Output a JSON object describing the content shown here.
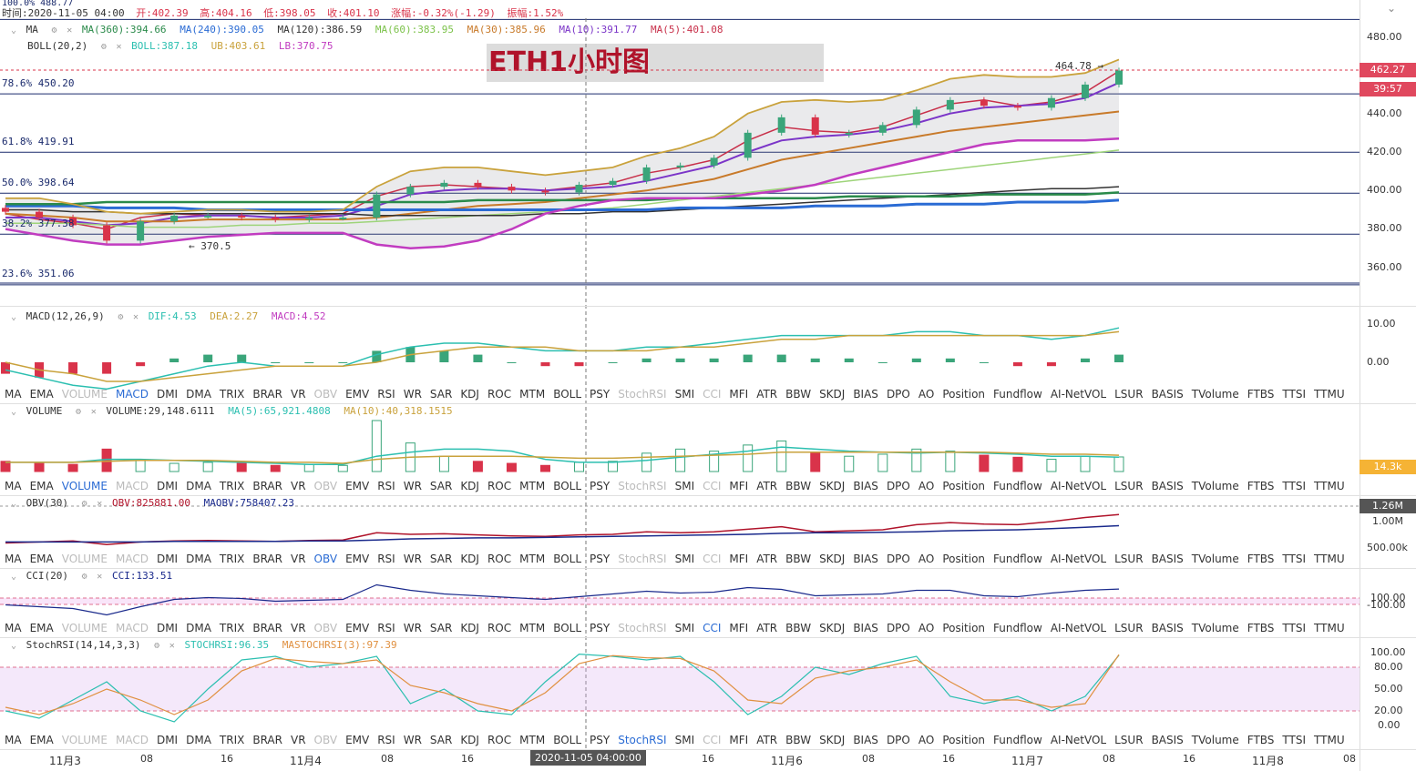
{
  "top": {
    "corner_label": "100.0% 488.77",
    "time": "时间:2020-11-05 04:00",
    "open": "开:402.39",
    "high": "高:404.16",
    "low": "低:398.05",
    "close": "收:401.10",
    "change": "涨幅:-0.32%(-1.29)",
    "amplitude": "振幅:1.52%"
  },
  "ma_legend": {
    "name": "MA",
    "ma360": "MA(360):394.66",
    "ma240": "MA(240):390.05",
    "ma120": "MA(120):386.59",
    "ma60": "MA(60):383.95",
    "ma30": "MA(30):385.96",
    "ma10": "MA(10):391.77",
    "ma5": "MA(5):401.08"
  },
  "boll_legend": {
    "name": "BOLL(20,2)",
    "boll": "BOLL:387.18",
    "ub": "UB:403.61",
    "lb": "LB:370.75"
  },
  "banner": "ETH1小时图",
  "fib": {
    "f786": "78.6% 450.20",
    "f618": "61.8% 419.91",
    "f500": "50.0% 398.64",
    "f382": "38.2% 377.38",
    "f236": "23.6% 351.06"
  },
  "annotations": {
    "high_mark": "464.78 →",
    "low_mark": "← 370.5"
  },
  "price_axis": [
    "480.00",
    "460.00",
    "440.00",
    "420.00",
    "400.00",
    "380.00",
    "360.00"
  ],
  "price_tag": "462.27",
  "countdown_tag": "39:57",
  "macd_legend": {
    "name": "MACD(12,26,9)",
    "dif": "DIF:4.53",
    "dea": "DEA:2.27",
    "macd": "MACD:4.52"
  },
  "macd_axis": [
    "10.00",
    "0.00"
  ],
  "volume_legend": {
    "name": "VOLUME",
    "volume": "VOLUME:29,148.6111",
    "ma5": "MA(5):65,921.4808",
    "ma10": "MA(10):40,318.1515"
  },
  "volume_tag": "14.3k",
  "obv_legend": {
    "name": "OBV(30)",
    "obv": "OBV:825881.00",
    "maobv": "MAOBV:758407.23"
  },
  "obv_tag": "1.26M",
  "obv_axis": [
    "1.00M",
    "500.00k"
  ],
  "cci_legend": {
    "name": "CCI(20)",
    "cci": "CCI:133.51"
  },
  "cci_axis": [
    "100.00",
    "-100.00"
  ],
  "stoch_legend": {
    "name": "StochRSI(14,14,3,3)",
    "stoch": "STOCHRSI:96.35",
    "ma": "MASTOCHRSI(3):97.39"
  },
  "stoch_axis": [
    "100.00",
    "80.00",
    "50.00",
    "20.00",
    "0.00"
  ],
  "tabs": [
    "MA",
    "EMA",
    "VOLUME",
    "MACD",
    "DMI",
    "DMA",
    "TRIX",
    "BRAR",
    "VR",
    "OBV",
    "EMV",
    "RSI",
    "WR",
    "SAR",
    "KDJ",
    "ROC",
    "MTM",
    "BOLL",
    "PSY",
    "StochRSI",
    "SMI",
    "CCI",
    "MFI",
    "ATR",
    "BBW",
    "SKDJ",
    "BIAS",
    "DPO",
    "AO",
    "Position",
    "Fundflow",
    "AI-NetVOL",
    "LSUR",
    "BASIS",
    "TVolume",
    "FTBS",
    "TTSI",
    "TTMU"
  ],
  "x_axis": [
    "11月3",
    "08",
    "16",
    "11月4",
    "08",
    "16",
    "16",
    "11月6",
    "08",
    "16",
    "11月7",
    "08",
    "16",
    "11月8",
    "08"
  ],
  "x_cursor": "2020-11-05 04:00:00",
  "colors": {
    "up": "#3aa57a",
    "down": "#d9334a",
    "boll": "#c9a23c",
    "ma5": "#c8304a",
    "ma10": "#7b35c8",
    "ma30": "#c87a2a",
    "ma60": "#9ed47a",
    "ma120": "#333333",
    "ma240": "#2a6bd4",
    "ma360": "#2a8a4a",
    "lb": "#c13cc0",
    "dif": "#2bbfb0",
    "dea": "#c9a23c"
  },
  "chart_data": {
    "type": "candlestick",
    "symbol": "ETH",
    "interval": "1h",
    "ylim": [
      340,
      490
    ],
    "fib_levels": [
      {
        "level": "100.0%",
        "price": 488.77
      },
      {
        "level": "78.6%",
        "price": 450.2
      },
      {
        "level": "61.8%",
        "price": 419.91
      },
      {
        "level": "50.0%",
        "price": 398.64
      },
      {
        "level": "38.2%",
        "price": 377.38
      },
      {
        "level": "23.6%",
        "price": 351.06
      }
    ],
    "ma_series": [
      {
        "name": "MA(5)",
        "values": [
          388,
          385,
          383,
          380,
          386,
          388,
          387,
          387,
          386,
          387,
          388,
          397,
          402,
          403,
          402,
          401,
          400,
          402,
          404,
          409,
          412,
          416,
          426,
          433,
          431,
          430,
          433,
          439,
          445,
          447,
          444,
          446,
          451,
          462
        ]
      },
      {
        "name": "MA(10)",
        "values": [
          386,
          386,
          384,
          382,
          383,
          386,
          387,
          387,
          386,
          386,
          387,
          392,
          398,
          400,
          401,
          401,
          400,
          401,
          402,
          405,
          409,
          413,
          420,
          426,
          428,
          429,
          431,
          435,
          440,
          443,
          444,
          445,
          448,
          456
        ]
      },
      {
        "name": "MA(30)",
        "values": [
          388,
          387,
          386,
          384,
          384,
          384,
          385,
          385,
          385,
          385,
          385,
          386,
          388,
          390,
          392,
          393,
          394,
          396,
          398,
          400,
          403,
          406,
          411,
          416,
          419,
          422,
          425,
          428,
          431,
          433,
          435,
          437,
          439,
          441
        ]
      },
      {
        "name": "MA(60)",
        "values": [
          383,
          383,
          383,
          382,
          381,
          381,
          381,
          382,
          382,
          383,
          383,
          384,
          385,
          386,
          387,
          388,
          389,
          390,
          391,
          393,
          395,
          397,
          399,
          401,
          403,
          405,
          407,
          409,
          411,
          413,
          415,
          417,
          419,
          421
        ]
      },
      {
        "name": "MA(120)",
        "values": [
          390,
          390,
          389,
          389,
          388,
          388,
          388,
          388,
          388,
          388,
          388,
          387,
          387,
          387,
          387,
          387,
          388,
          388,
          389,
          389,
          390,
          391,
          392,
          393,
          394,
          395,
          396,
          397,
          398,
          399,
          400,
          401,
          401,
          402
        ]
      },
      {
        "name": "MA(240)",
        "values": [
          392,
          392,
          392,
          391,
          391,
          391,
          390,
          390,
          390,
          390,
          390,
          390,
          390,
          390,
          390,
          390,
          390,
          390,
          390,
          390,
          391,
          391,
          391,
          391,
          392,
          392,
          392,
          393,
          393,
          393,
          394,
          394,
          394,
          395
        ]
      },
      {
        "name": "MA(360)",
        "values": [
          393,
          393,
          393,
          394,
          394,
          394,
          394,
          394,
          394,
          394,
          394,
          394,
          394,
          394,
          395,
          395,
          395,
          395,
          395,
          395,
          396,
          396,
          396,
          396,
          396,
          397,
          397,
          397,
          397,
          398,
          398,
          398,
          398,
          399
        ]
      },
      {
        "name": "UB",
        "values": [
          396,
          396,
          393,
          389,
          388,
          389,
          390,
          390,
          389,
          389,
          390,
          402,
          410,
          412,
          412,
          410,
          408,
          410,
          412,
          418,
          422,
          428,
          440,
          446,
          447,
          446,
          447,
          452,
          458,
          460,
          459,
          459,
          461,
          468
        ]
      },
      {
        "name": "LB",
        "values": [
          380,
          377,
          374,
          372,
          372,
          374,
          376,
          377,
          378,
          378,
          378,
          372,
          370,
          371,
          374,
          380,
          388,
          392,
          395,
          396,
          396,
          396,
          398,
          400,
          403,
          408,
          412,
          416,
          420,
          424,
          426,
          426,
          426,
          427
        ]
      }
    ],
    "candles_close": [
      389,
      386,
      382,
      374,
      384,
      387,
      387,
      386,
      385,
      386,
      386,
      398,
      402,
      404,
      402,
      400,
      399,
      403,
      405,
      412,
      413,
      417,
      430,
      438,
      429,
      430,
      434,
      442,
      447,
      444,
      443,
      448,
      455,
      462.27
    ],
    "candles_open": [
      391,
      389,
      386,
      382,
      374,
      384,
      387,
      387,
      386,
      385,
      386,
      386,
      398,
      402,
      404,
      402,
      400,
      399,
      403,
      405,
      412,
      413,
      417,
      430,
      438,
      429,
      430,
      434,
      442,
      447,
      444,
      443,
      448,
      455
    ],
    "macd": {
      "dif": [
        -2,
        -4,
        -6,
        -7,
        -5,
        -3,
        -1,
        0,
        -1,
        -1,
        -1,
        2,
        4,
        5,
        5,
        4,
        3,
        3,
        3,
        4,
        4,
        5,
        6,
        7,
        7,
        7,
        7,
        8,
        8,
        7,
        7,
        6,
        7,
        9
      ],
      "dea": [
        0,
        -2,
        -3,
        -5,
        -5,
        -4,
        -3,
        -2,
        -1,
        -1,
        -1,
        0,
        2,
        3,
        4,
        4,
        4,
        3,
        3,
        3,
        4,
        4,
        5,
        6,
        6,
        7,
        7,
        7,
        7,
        7,
        7,
        7,
        7,
        8
      ],
      "hist": [
        -3,
        -4,
        -3,
        -3,
        -1,
        1,
        2,
        2,
        0,
        0,
        0,
        3,
        4,
        3,
        2,
        0,
        -1,
        -1,
        0,
        1,
        1,
        1,
        2,
        2,
        1,
        1,
        0,
        1,
        1,
        0,
        -1,
        -1,
        1,
        2
      ]
    },
    "volume": {
      "values": [
        10,
        8,
        7,
        22,
        12,
        8,
        9,
        8,
        6,
        7,
        6,
        50,
        28,
        15,
        10,
        8,
        6,
        9,
        10,
        18,
        22,
        20,
        26,
        30,
        18,
        15,
        17,
        22,
        20,
        16,
        14,
        12,
        15,
        14.3
      ],
      "ma5": [
        9,
        9,
        9,
        12,
        12,
        11,
        10,
        9,
        8,
        7,
        7,
        15,
        19,
        22,
        22,
        20,
        12,
        9,
        9,
        11,
        14,
        17,
        20,
        24,
        22,
        20,
        19,
        18,
        19,
        18,
        17,
        15,
        15,
        14
      ],
      "ma10": [
        9,
        9,
        9,
        10,
        11,
        11,
        11,
        10,
        9,
        9,
        8,
        12,
        14,
        15,
        15,
        15,
        14,
        13,
        13,
        14,
        15,
        16,
        17,
        19,
        19,
        19,
        19,
        19,
        19,
        19,
        18,
        17,
        17,
        16
      ]
    },
    "obv": {
      "obv": [
        0.58,
        0.6,
        0.62,
        0.55,
        0.6,
        0.62,
        0.63,
        0.62,
        0.61,
        0.63,
        0.64,
        0.78,
        0.75,
        0.76,
        0.74,
        0.72,
        0.71,
        0.74,
        0.75,
        0.8,
        0.78,
        0.8,
        0.85,
        0.9,
        0.8,
        0.82,
        0.84,
        0.94,
        0.98,
        0.95,
        0.94,
        1.0,
        1.08,
        1.14
      ],
      "maobv": [
        0.6,
        0.6,
        0.6,
        0.6,
        0.6,
        0.61,
        0.61,
        0.61,
        0.61,
        0.62,
        0.62,
        0.64,
        0.66,
        0.67,
        0.68,
        0.68,
        0.69,
        0.7,
        0.71,
        0.72,
        0.73,
        0.74,
        0.75,
        0.77,
        0.78,
        0.78,
        0.79,
        0.8,
        0.82,
        0.83,
        0.84,
        0.86,
        0.89,
        0.92
      ]
    },
    "cci": [
      -40,
      -60,
      -80,
      -150,
      -60,
      20,
      40,
      30,
      0,
      10,
      20,
      180,
      120,
      80,
      60,
      40,
      20,
      50,
      80,
      110,
      90,
      100,
      150,
      130,
      60,
      70,
      80,
      120,
      120,
      60,
      50,
      90,
      120,
      133.51
    ],
    "stochrsi": {
      "k": [
        20,
        10,
        35,
        60,
        20,
        5,
        50,
        90,
        95,
        80,
        85,
        95,
        30,
        50,
        20,
        15,
        60,
        98,
        95,
        90,
        95,
        60,
        15,
        40,
        80,
        70,
        85,
        95,
        40,
        30,
        40,
        20,
        40,
        96.35
      ],
      "d": [
        25,
        15,
        30,
        50,
        35,
        15,
        35,
        75,
        92,
        88,
        85,
        90,
        55,
        45,
        30,
        20,
        45,
        85,
        96,
        93,
        92,
        75,
        35,
        30,
        65,
        75,
        80,
        90,
        60,
        35,
        35,
        25,
        30,
        97.39
      ]
    }
  }
}
